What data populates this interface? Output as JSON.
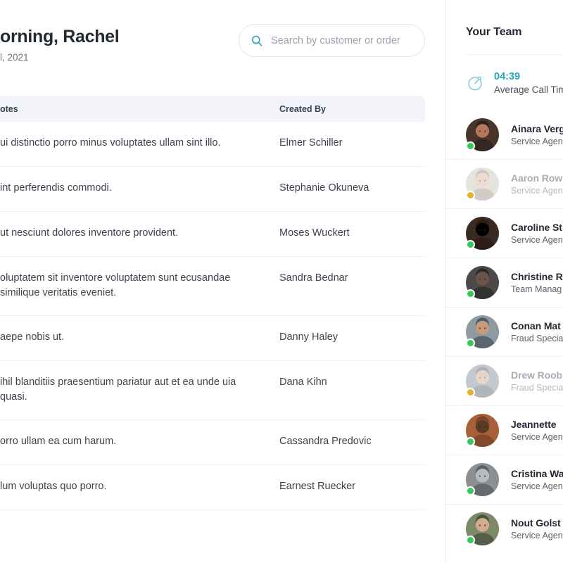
{
  "header": {
    "greeting": "orning, Rachel",
    "greeting_full": "Good morning, Rachel",
    "date": "l, 2021"
  },
  "search": {
    "placeholder": "Search by customer or order",
    "value": "",
    "icon": "search-icon",
    "icon_color": "#2aa5b8"
  },
  "table": {
    "columns": [
      "otes",
      "Created By"
    ],
    "columns_full": [
      "Notes",
      "Created By"
    ],
    "header_bg": "#f2f4fa",
    "rows": [
      {
        "notes": "ui distinctio porro minus voluptates ullam sint illo.",
        "created_by": "Elmer Schiller"
      },
      {
        "notes": "int perferendis commodi.",
        "created_by": "Stephanie Okuneva"
      },
      {
        "notes": "ut nesciunt dolores inventore provident.",
        "created_by": "Moses Wuckert"
      },
      {
        "notes": "oluptatem sit inventore voluptatem sunt ecusandae similique veritatis eveniet.",
        "created_by": "Sandra Bednar"
      },
      {
        "notes": "aepe nobis ut.",
        "created_by": "Danny Haley"
      },
      {
        "notes": "ihil blanditiis praesentium pariatur aut et ea unde uia quasi.",
        "created_by": "Dana Kihn"
      },
      {
        "notes": "orro ullam ea cum harum.",
        "created_by": "Cassandra Predovic"
      },
      {
        "notes": "lum voluptas quo porro.",
        "created_by": "Earnest Ruecker"
      }
    ]
  },
  "team": {
    "title": "Your Team",
    "stat": {
      "icon": "stopwatch-icon",
      "value": "04:39",
      "label": "Average Call Tim",
      "label_full": "Average Call Time",
      "value_color": "#2aa5b8"
    },
    "status_colors": {
      "online": "#34c759",
      "away": "#e8b427"
    },
    "members": [
      {
        "name": "Ainara Verg",
        "name_full": "Ainara Vergara",
        "role": "Service Agen",
        "role_full": "Service Agent",
        "status": "online"
      },
      {
        "name": "Aaron Row",
        "name_full": "Aaron Rowland",
        "role": "Service Agen",
        "role_full": "Service Agent",
        "status": "away"
      },
      {
        "name": "Caroline St",
        "name_full": "Caroline Stokes",
        "role": "Service Agen",
        "role_full": "Service Agent",
        "status": "online"
      },
      {
        "name": "Christine R",
        "name_full": "Christine Rivera",
        "role": "Team Manag",
        "role_full": "Team Manager",
        "status": "online"
      },
      {
        "name": "Conan Mat",
        "name_full": "Conan Matthews",
        "role": "Fraud Specia",
        "role_full": "Fraud Specialist",
        "status": "online"
      },
      {
        "name": "Drew Roob",
        "name_full": "Drew Roob",
        "role": "Fraud Specia",
        "role_full": "Fraud Specialist",
        "status": "away"
      },
      {
        "name": "Jeannette",
        "name_full": "Jeannette Okon",
        "role": "Service Agen",
        "role_full": "Service Agent",
        "status": "online"
      },
      {
        "name": "Cristina Wa",
        "name_full": "Cristina Walsh",
        "role": "Service Agen",
        "role_full": "Service Agent",
        "status": "online"
      },
      {
        "name": "Nout Golst",
        "name_full": "Nout Golstein",
        "role": "Service Agen",
        "role_full": "Service Agent",
        "status": "online"
      }
    ]
  }
}
